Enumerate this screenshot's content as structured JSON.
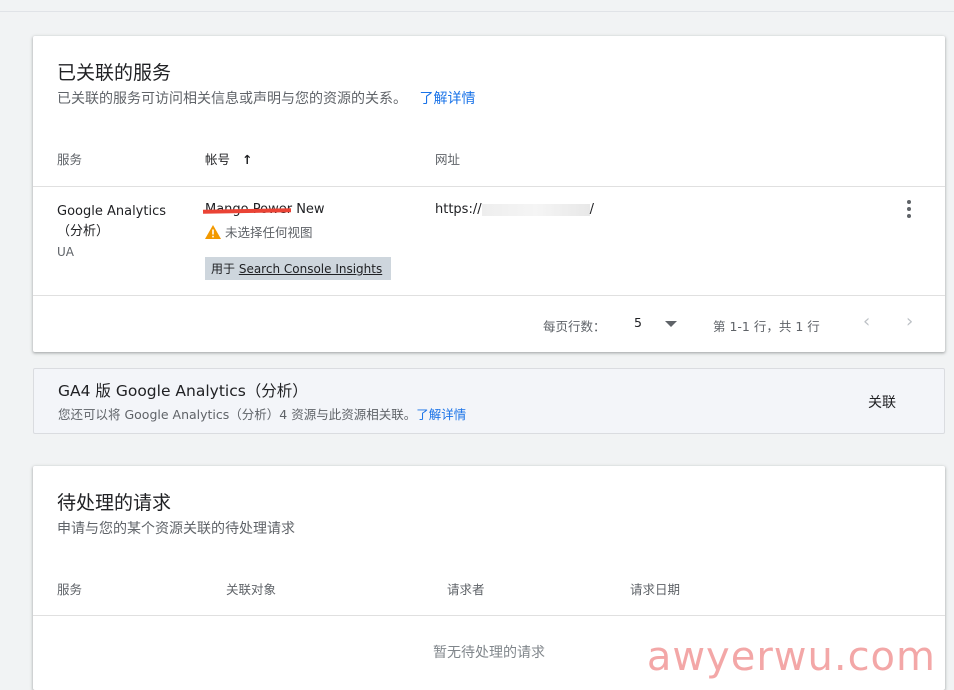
{
  "linked": {
    "title": "已关联的服务",
    "subtitle": "已关联的服务可访问相关信息或声明与您的资源的关系。",
    "learn_more": "了解详情",
    "columns": {
      "service": "服务",
      "account": "帐号",
      "url": "网址"
    },
    "sort_arrow": "↑",
    "row": {
      "service_line1": "Google Analytics",
      "service_line2": "（分析）",
      "service_type": "UA",
      "account": "Mango Power New",
      "warning": "未选择任何视图",
      "chip_prefix": "用于 ",
      "chip_link": "Search Console Insights",
      "url_prefix": "https://",
      "url_suffix": "/"
    },
    "footer": {
      "rows_per_page_label": "每页行数：",
      "rows_per_page_value": "5",
      "range": "第 1-1 行，共 1 行"
    }
  },
  "ga4": {
    "title": "GA4 版 Google Analytics（分析）",
    "subtitle": "您还可以将 Google Analytics（分析）4 资源与此资源相关联。",
    "learn_more": "了解详情",
    "action": "关联"
  },
  "pending": {
    "title": "待处理的请求",
    "subtitle": "申请与您的某个资源关联的待处理请求",
    "columns": {
      "service": "服务",
      "target": "关联对象",
      "requester": "请求者",
      "date": "请求日期"
    },
    "empty": "暂无待处理的请求"
  },
  "watermark": "awyerwu.com",
  "colors": {
    "link": "#1a73e8",
    "warning": "#f29900",
    "redaction": "#ea4335"
  }
}
